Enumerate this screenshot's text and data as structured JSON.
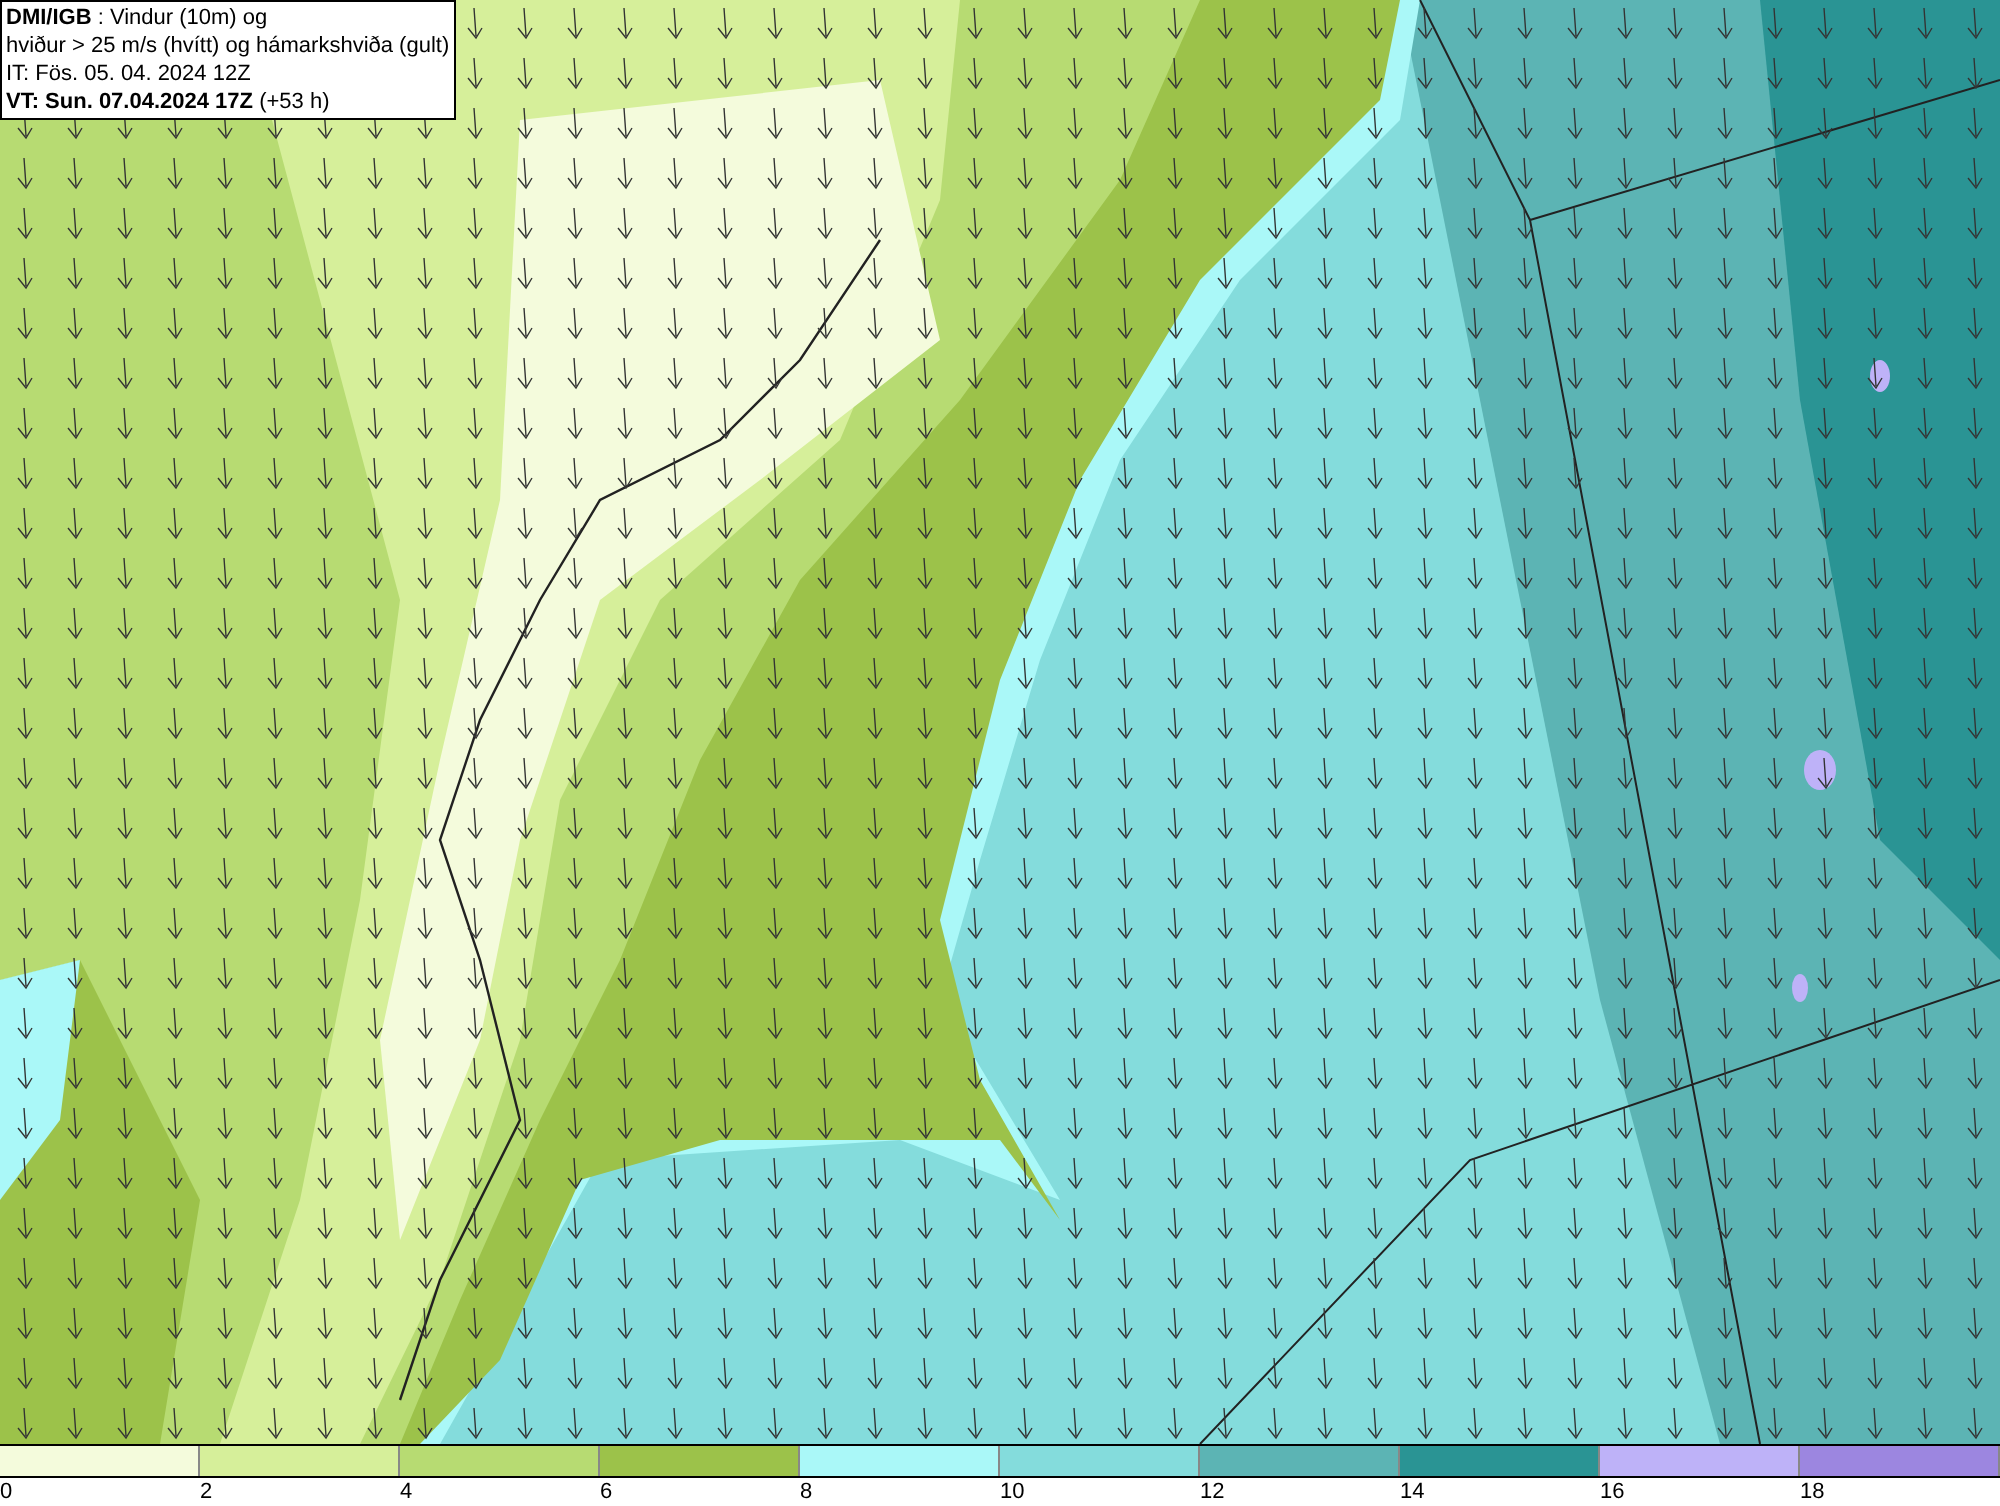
{
  "title_box": {
    "lines": [
      "**DMI/IGB** : Vindur (10m) og",
      "hviður > 25 m/s (hvítt) og hámarkshviða (gult)",
      "IT: Fös. 05. 04. 2024 12Z",
      "**VT: Sun. 07.04.2024 17Z** (+53 h)"
    ]
  },
  "legend": [
    {
      "label": "0",
      "color": "#f4fbdc"
    },
    {
      "label": "2",
      "color": "#d6ef9a"
    },
    {
      "label": "4",
      "color": "#b7db72"
    },
    {
      "label": "6",
      "color": "#9cc24a"
    },
    {
      "label": "8",
      "color": "#aaf8f8"
    },
    {
      "label": "10",
      "color": "#84dcdc"
    },
    {
      "label": "12",
      "color": "#5cb4b4"
    },
    {
      "label": "14",
      "color": "#2a9494"
    },
    {
      "label": "16",
      "color": "#beb2f8"
    },
    {
      "label": "18",
      "color": "#9c86e0"
    }
  ]
}
